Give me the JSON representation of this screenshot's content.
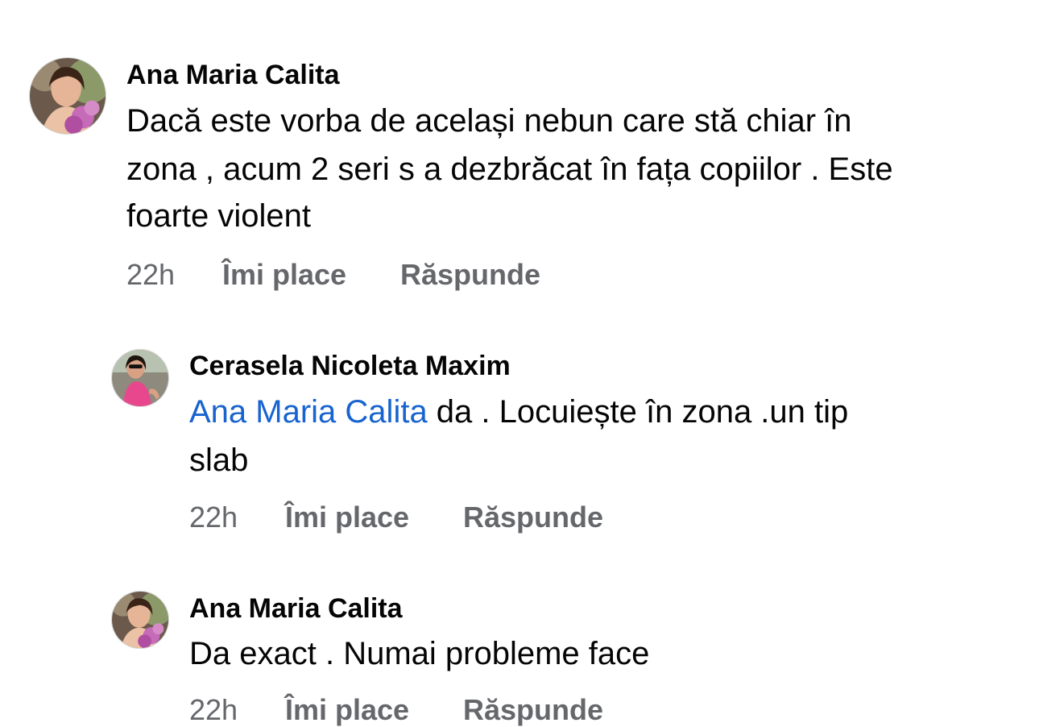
{
  "comments": [
    {
      "author": "Ana Maria Calita",
      "lines": [
        "Dacă este vorba de același nebun care stă chiar în",
        "zona , acum 2 seri s a dezbrăcat în fața copiilor . Este",
        "foarte violent"
      ],
      "time": "22h",
      "like_label": "Îmi place",
      "reply_label": "Răspunde"
    },
    {
      "author": "Cerasela Nicoleta Maxim",
      "mention": "Ana Maria Calita",
      "lines": [
        " da . Locuiește în zona .un tip",
        "slab"
      ],
      "time": "22h",
      "like_label": "Îmi place",
      "reply_label": "Răspunde"
    },
    {
      "author": "Ana Maria Calita",
      "lines": [
        "Da exact . Numai probleme face"
      ],
      "time": "22h",
      "like_label": "Îmi place",
      "reply_label": "Răspunde"
    }
  ],
  "colors": {
    "mention": "#1763cf",
    "meta": "#65676b",
    "text": "#050505"
  }
}
